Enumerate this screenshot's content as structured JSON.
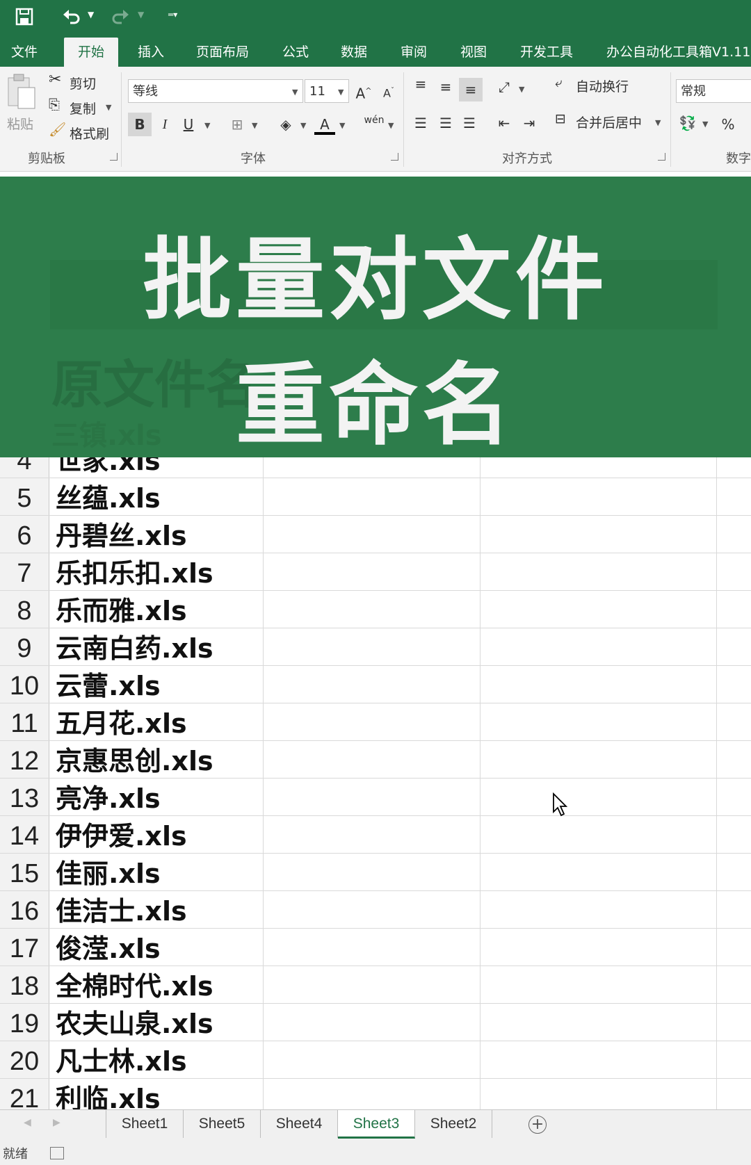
{
  "colors": {
    "accent": "#217346",
    "banner": "#2d7d4b",
    "banner_text": "#f3f3f3"
  },
  "quick_access": {
    "save_icon": "save-icon",
    "undo_icon": "undo-icon",
    "redo_icon": "redo-icon",
    "customize_icon": "customize-qat-icon"
  },
  "tabs": [
    {
      "label": "文件"
    },
    {
      "label": "开始",
      "active": true
    },
    {
      "label": "插入"
    },
    {
      "label": "页面布局"
    },
    {
      "label": "公式"
    },
    {
      "label": "数据"
    },
    {
      "label": "审阅"
    },
    {
      "label": "视图"
    },
    {
      "label": "开发工具"
    },
    {
      "label": "办公自动化工具箱V1.11"
    }
  ],
  "ribbon": {
    "clipboard": {
      "paste": "粘贴",
      "cut": "剪切",
      "copy": "复制",
      "format_painter": "格式刷",
      "group_label": "剪贴板"
    },
    "font": {
      "name": "等线",
      "size": "11",
      "bold": "B",
      "italic": "I",
      "underline": "U",
      "group_label": "字体",
      "phonetic": "wén"
    },
    "alignment": {
      "wrap_text": "自动换行",
      "merge_center": "合并后居中",
      "group_label": "对齐方式"
    },
    "number": {
      "format": "常规",
      "percent": "%",
      "group_label": "数字"
    }
  },
  "banner": {
    "title_line1": "批量对文件",
    "title_line2": "重命名",
    "ghost_header": "原文件名",
    "ghost_row": "三镇.xls"
  },
  "grid": {
    "rows": [
      {
        "num": "4",
        "name": "世家.xls"
      },
      {
        "num": "5",
        "name": "丝蕴.xls"
      },
      {
        "num": "6",
        "name": "丹碧丝.xls"
      },
      {
        "num": "7",
        "name": "乐扣乐扣.xls"
      },
      {
        "num": "8",
        "name": "乐而雅.xls"
      },
      {
        "num": "9",
        "name": "云南白药.xls"
      },
      {
        "num": "10",
        "name": "云蕾.xls"
      },
      {
        "num": "11",
        "name": "五月花.xls"
      },
      {
        "num": "12",
        "name": "京惠思创.xls"
      },
      {
        "num": "13",
        "name": "亮净.xls"
      },
      {
        "num": "14",
        "name": "伊伊爱.xls"
      },
      {
        "num": "15",
        "name": "佳丽.xls"
      },
      {
        "num": "16",
        "name": "佳洁士.xls"
      },
      {
        "num": "17",
        "name": "俊滢.xls"
      },
      {
        "num": "18",
        "name": "全棉时代.xls"
      },
      {
        "num": "19",
        "name": "农夫山泉.xls"
      },
      {
        "num": "20",
        "name": "凡士林.xls"
      },
      {
        "num": "21",
        "name": "利临.xls"
      }
    ]
  },
  "sheets": [
    {
      "label": "Sheet1"
    },
    {
      "label": "Sheet5"
    },
    {
      "label": "Sheet4"
    },
    {
      "label": "Sheet3",
      "active": true
    },
    {
      "label": "Sheet2"
    }
  ],
  "status": {
    "text": "就绪"
  }
}
